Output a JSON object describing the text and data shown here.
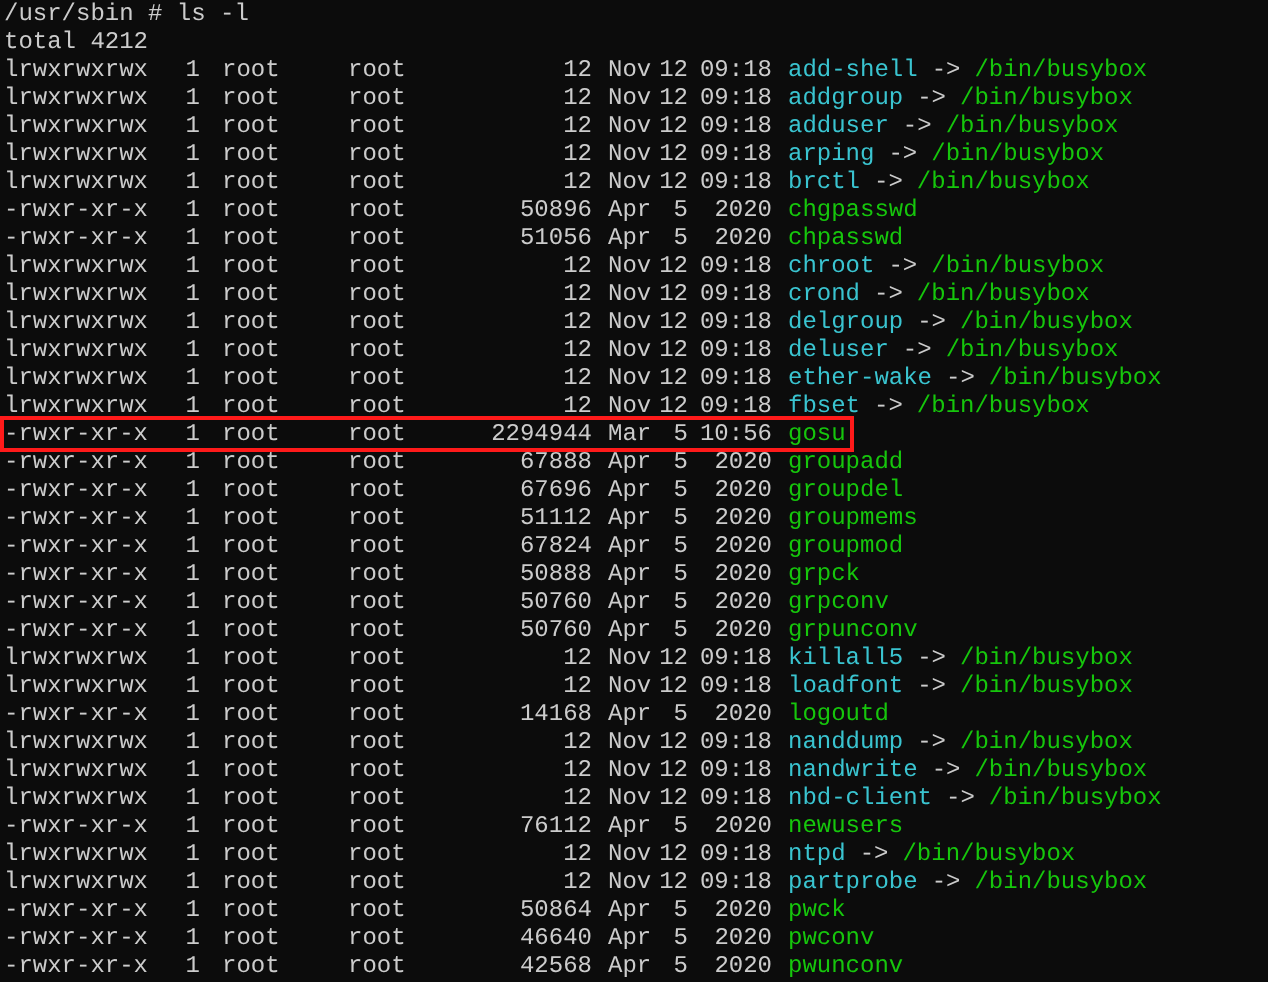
{
  "prompt": "/usr/sbin # ls -l",
  "total": "total 4212",
  "rows": [
    {
      "perms": "lrwxrwxrwx",
      "links": "1",
      "owner": "root",
      "group": "root",
      "size": "12",
      "month": "Nov",
      "day": "12",
      "time": "09:18",
      "name": "add-shell",
      "kind": "link",
      "arrow": "->",
      "target": "/bin/busybox",
      "highlighted": false
    },
    {
      "perms": "lrwxrwxrwx",
      "links": "1",
      "owner": "root",
      "group": "root",
      "size": "12",
      "month": "Nov",
      "day": "12",
      "time": "09:18",
      "name": "addgroup",
      "kind": "link",
      "arrow": "->",
      "target": "/bin/busybox",
      "highlighted": false
    },
    {
      "perms": "lrwxrwxrwx",
      "links": "1",
      "owner": "root",
      "group": "root",
      "size": "12",
      "month": "Nov",
      "day": "12",
      "time": "09:18",
      "name": "adduser",
      "kind": "link",
      "arrow": "->",
      "target": "/bin/busybox",
      "highlighted": false
    },
    {
      "perms": "lrwxrwxrwx",
      "links": "1",
      "owner": "root",
      "group": "root",
      "size": "12",
      "month": "Nov",
      "day": "12",
      "time": "09:18",
      "name": "arping",
      "kind": "link",
      "arrow": "->",
      "target": "/bin/busybox",
      "highlighted": false
    },
    {
      "perms": "lrwxrwxrwx",
      "links": "1",
      "owner": "root",
      "group": "root",
      "size": "12",
      "month": "Nov",
      "day": "12",
      "time": "09:18",
      "name": "brctl",
      "kind": "link",
      "arrow": "->",
      "target": "/bin/busybox",
      "highlighted": false
    },
    {
      "perms": "-rwxr-xr-x",
      "links": "1",
      "owner": "root",
      "group": "root",
      "size": "50896",
      "month": "Apr",
      "day": "5",
      "time": "2020",
      "name": "chgpasswd",
      "kind": "exec",
      "highlighted": false
    },
    {
      "perms": "-rwxr-xr-x",
      "links": "1",
      "owner": "root",
      "group": "root",
      "size": "51056",
      "month": "Apr",
      "day": "5",
      "time": "2020",
      "name": "chpasswd",
      "kind": "exec",
      "highlighted": false
    },
    {
      "perms": "lrwxrwxrwx",
      "links": "1",
      "owner": "root",
      "group": "root",
      "size": "12",
      "month": "Nov",
      "day": "12",
      "time": "09:18",
      "name": "chroot",
      "kind": "link",
      "arrow": "->",
      "target": "/bin/busybox",
      "highlighted": false
    },
    {
      "perms": "lrwxrwxrwx",
      "links": "1",
      "owner": "root",
      "group": "root",
      "size": "12",
      "month": "Nov",
      "day": "12",
      "time": "09:18",
      "name": "crond",
      "kind": "link",
      "arrow": "->",
      "target": "/bin/busybox",
      "highlighted": false
    },
    {
      "perms": "lrwxrwxrwx",
      "links": "1",
      "owner": "root",
      "group": "root",
      "size": "12",
      "month": "Nov",
      "day": "12",
      "time": "09:18",
      "name": "delgroup",
      "kind": "link",
      "arrow": "->",
      "target": "/bin/busybox",
      "highlighted": false
    },
    {
      "perms": "lrwxrwxrwx",
      "links": "1",
      "owner": "root",
      "group": "root",
      "size": "12",
      "month": "Nov",
      "day": "12",
      "time": "09:18",
      "name": "deluser",
      "kind": "link",
      "arrow": "->",
      "target": "/bin/busybox",
      "highlighted": false
    },
    {
      "perms": "lrwxrwxrwx",
      "links": "1",
      "owner": "root",
      "group": "root",
      "size": "12",
      "month": "Nov",
      "day": "12",
      "time": "09:18",
      "name": "ether-wake",
      "kind": "link",
      "arrow": "->",
      "target": "/bin/busybox",
      "highlighted": false
    },
    {
      "perms": "lrwxrwxrwx",
      "links": "1",
      "owner": "root",
      "group": "root",
      "size": "12",
      "month": "Nov",
      "day": "12",
      "time": "09:18",
      "name": "fbset",
      "kind": "link",
      "arrow": "->",
      "target": "/bin/busybox",
      "highlighted": false
    },
    {
      "perms": "-rwxr-xr-x",
      "links": "1",
      "owner": "root",
      "group": "root",
      "size": "2294944",
      "month": "Mar",
      "day": "5",
      "time": "10:56",
      "name": "gosu",
      "kind": "exec",
      "highlighted": true
    },
    {
      "perms": "-rwxr-xr-x",
      "links": "1",
      "owner": "root",
      "group": "root",
      "size": "67888",
      "month": "Apr",
      "day": "5",
      "time": "2020",
      "name": "groupadd",
      "kind": "exec",
      "highlighted": false
    },
    {
      "perms": "-rwxr-xr-x",
      "links": "1",
      "owner": "root",
      "group": "root",
      "size": "67696",
      "month": "Apr",
      "day": "5",
      "time": "2020",
      "name": "groupdel",
      "kind": "exec",
      "highlighted": false
    },
    {
      "perms": "-rwxr-xr-x",
      "links": "1",
      "owner": "root",
      "group": "root",
      "size": "51112",
      "month": "Apr",
      "day": "5",
      "time": "2020",
      "name": "groupmems",
      "kind": "exec",
      "highlighted": false
    },
    {
      "perms": "-rwxr-xr-x",
      "links": "1",
      "owner": "root",
      "group": "root",
      "size": "67824",
      "month": "Apr",
      "day": "5",
      "time": "2020",
      "name": "groupmod",
      "kind": "exec",
      "highlighted": false
    },
    {
      "perms": "-rwxr-xr-x",
      "links": "1",
      "owner": "root",
      "group": "root",
      "size": "50888",
      "month": "Apr",
      "day": "5",
      "time": "2020",
      "name": "grpck",
      "kind": "exec",
      "highlighted": false
    },
    {
      "perms": "-rwxr-xr-x",
      "links": "1",
      "owner": "root",
      "group": "root",
      "size": "50760",
      "month": "Apr",
      "day": "5",
      "time": "2020",
      "name": "grpconv",
      "kind": "exec",
      "highlighted": false
    },
    {
      "perms": "-rwxr-xr-x",
      "links": "1",
      "owner": "root",
      "group": "root",
      "size": "50760",
      "month": "Apr",
      "day": "5",
      "time": "2020",
      "name": "grpunconv",
      "kind": "exec",
      "highlighted": false
    },
    {
      "perms": "lrwxrwxrwx",
      "links": "1",
      "owner": "root",
      "group": "root",
      "size": "12",
      "month": "Nov",
      "day": "12",
      "time": "09:18",
      "name": "killall5",
      "kind": "link",
      "arrow": "->",
      "target": "/bin/busybox",
      "highlighted": false
    },
    {
      "perms": "lrwxrwxrwx",
      "links": "1",
      "owner": "root",
      "group": "root",
      "size": "12",
      "month": "Nov",
      "day": "12",
      "time": "09:18",
      "name": "loadfont",
      "kind": "link",
      "arrow": "->",
      "target": "/bin/busybox",
      "highlighted": false
    },
    {
      "perms": "-rwxr-xr-x",
      "links": "1",
      "owner": "root",
      "group": "root",
      "size": "14168",
      "month": "Apr",
      "day": "5",
      "time": "2020",
      "name": "logoutd",
      "kind": "exec",
      "highlighted": false
    },
    {
      "perms": "lrwxrwxrwx",
      "links": "1",
      "owner": "root",
      "group": "root",
      "size": "12",
      "month": "Nov",
      "day": "12",
      "time": "09:18",
      "name": "nanddump",
      "kind": "link",
      "arrow": "->",
      "target": "/bin/busybox",
      "highlighted": false
    },
    {
      "perms": "lrwxrwxrwx",
      "links": "1",
      "owner": "root",
      "group": "root",
      "size": "12",
      "month": "Nov",
      "day": "12",
      "time": "09:18",
      "name": "nandwrite",
      "kind": "link",
      "arrow": "->",
      "target": "/bin/busybox",
      "highlighted": false
    },
    {
      "perms": "lrwxrwxrwx",
      "links": "1",
      "owner": "root",
      "group": "root",
      "size": "12",
      "month": "Nov",
      "day": "12",
      "time": "09:18",
      "name": "nbd-client",
      "kind": "link",
      "arrow": "->",
      "target": "/bin/busybox",
      "highlighted": false
    },
    {
      "perms": "-rwxr-xr-x",
      "links": "1",
      "owner": "root",
      "group": "root",
      "size": "76112",
      "month": "Apr",
      "day": "5",
      "time": "2020",
      "name": "newusers",
      "kind": "exec",
      "highlighted": false
    },
    {
      "perms": "lrwxrwxrwx",
      "links": "1",
      "owner": "root",
      "group": "root",
      "size": "12",
      "month": "Nov",
      "day": "12",
      "time": "09:18",
      "name": "ntpd",
      "kind": "link",
      "arrow": "->",
      "target": "/bin/busybox",
      "highlighted": false
    },
    {
      "perms": "lrwxrwxrwx",
      "links": "1",
      "owner": "root",
      "group": "root",
      "size": "12",
      "month": "Nov",
      "day": "12",
      "time": "09:18",
      "name": "partprobe",
      "kind": "link",
      "arrow": "->",
      "target": "/bin/busybox",
      "highlighted": false
    },
    {
      "perms": "-rwxr-xr-x",
      "links": "1",
      "owner": "root",
      "group": "root",
      "size": "50864",
      "month": "Apr",
      "day": "5",
      "time": "2020",
      "name": "pwck",
      "kind": "exec",
      "highlighted": false
    },
    {
      "perms": "-rwxr-xr-x",
      "links": "1",
      "owner": "root",
      "group": "root",
      "size": "46640",
      "month": "Apr",
      "day": "5",
      "time": "2020",
      "name": "pwconv",
      "kind": "exec",
      "highlighted": false
    },
    {
      "perms": "-rwxr-xr-x",
      "links": "1",
      "owner": "root",
      "group": "root",
      "size": "42568",
      "month": "Apr",
      "day": "5",
      "time": "2020",
      "name": "pwunconv",
      "kind": "exec",
      "highlighted": false
    }
  ]
}
